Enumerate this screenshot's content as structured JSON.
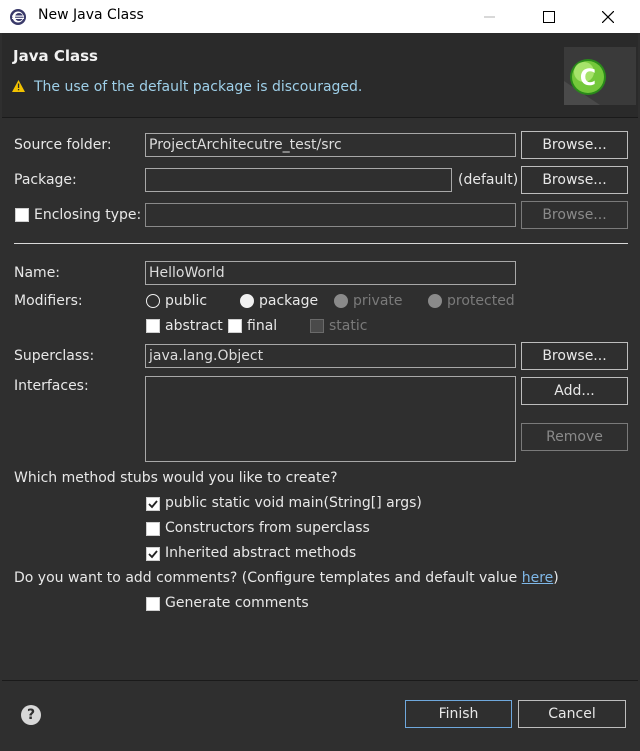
{
  "window": {
    "title": "New Java Class",
    "minimize_icon": "minimize-icon",
    "maximize_icon": "maximize-icon",
    "close_icon": "close-icon"
  },
  "header": {
    "title": "Java Class",
    "warning_icon": "warning-icon",
    "warning_text": "The use of the default package is discouraged.",
    "banner_icon": "new-class-wizard-icon",
    "banner_letter": "C"
  },
  "form": {
    "source_folder": {
      "label": "Source folder:",
      "value": "ProjectArchitecutre_test/src",
      "browse_label": "Browse..."
    },
    "package": {
      "label": "Package:",
      "value": "",
      "default_hint": "(default)",
      "browse_label": "Browse..."
    },
    "enclosing_type": {
      "label": "Enclosing type:",
      "checked": false,
      "value": "",
      "browse_label": "Browse..."
    },
    "name": {
      "label": "Name:",
      "value": "HelloWorld"
    },
    "modifiers": {
      "label": "Modifiers:",
      "access": [
        {
          "label": "public",
          "selected": true,
          "enabled": true
        },
        {
          "label": "package",
          "selected": false,
          "enabled": true
        },
        {
          "label": "private",
          "selected": false,
          "enabled": false
        },
        {
          "label": "protected",
          "selected": false,
          "enabled": false
        }
      ],
      "flags": [
        {
          "label": "abstract",
          "checked": false,
          "enabled": true
        },
        {
          "label": "final",
          "checked": false,
          "enabled": true
        },
        {
          "label": "static",
          "checked": false,
          "enabled": false
        }
      ]
    },
    "superclass": {
      "label": "Superclass:",
      "value": "java.lang.Object",
      "browse_label": "Browse..."
    },
    "interfaces": {
      "label": "Interfaces:",
      "add_label": "Add...",
      "remove_label": "Remove"
    },
    "method_stubs": {
      "question": "Which method stubs would you like to create?",
      "options": [
        {
          "label": "public static void main(String[] args)",
          "checked": true
        },
        {
          "label": "Constructors from superclass",
          "checked": false
        },
        {
          "label": "Inherited abstract methods",
          "checked": true
        }
      ]
    },
    "comments": {
      "question_prefix": "Do you want to add comments? (Configure templates and default value ",
      "link_text": "here",
      "question_suffix": ")",
      "generate_label": "Generate comments",
      "generate_checked": false
    }
  },
  "footer": {
    "help_icon": "help-icon",
    "finish_label": "Finish",
    "cancel_label": "Cancel"
  }
}
